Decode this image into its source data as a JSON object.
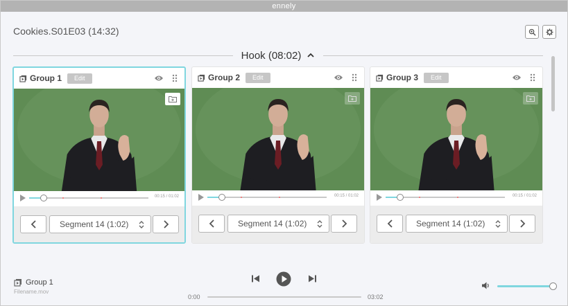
{
  "app": {
    "title": "ennely"
  },
  "document": {
    "title": "Cookies.S01E03 (14:32)"
  },
  "toolbar": {
    "zoom_icon": "zoom-icon",
    "settings_icon": "gear-icon"
  },
  "section": {
    "title": "Hook (08:02)",
    "collapse_icon": "chevron-up-icon"
  },
  "colors": {
    "accent": "#7fd6df",
    "marker": "#f08080",
    "video_bg": "#5e8a52"
  },
  "groups": [
    {
      "label": "Group 1",
      "edit_label": "Edit",
      "time": "00:15 / 01:02",
      "segment": "Segment 14 (1:02)",
      "selected": true,
      "progress": 0.12
    },
    {
      "label": "Group 2",
      "edit_label": "Edit",
      "time": "00:15 / 01:02",
      "segment": "Segment 14 (1:02)",
      "selected": false,
      "progress": 0.12
    },
    {
      "label": "Group 3",
      "edit_label": "Edit",
      "time": "00:15 / 01:02",
      "segment": "Segment 14 (1:02)",
      "selected": false,
      "progress": 0.12
    }
  ],
  "player": {
    "group": "Group 1",
    "filename": "Filename.mov",
    "start_time": "0:00",
    "end_time": "03:02",
    "progress": 0.0,
    "volume": 1.0
  }
}
